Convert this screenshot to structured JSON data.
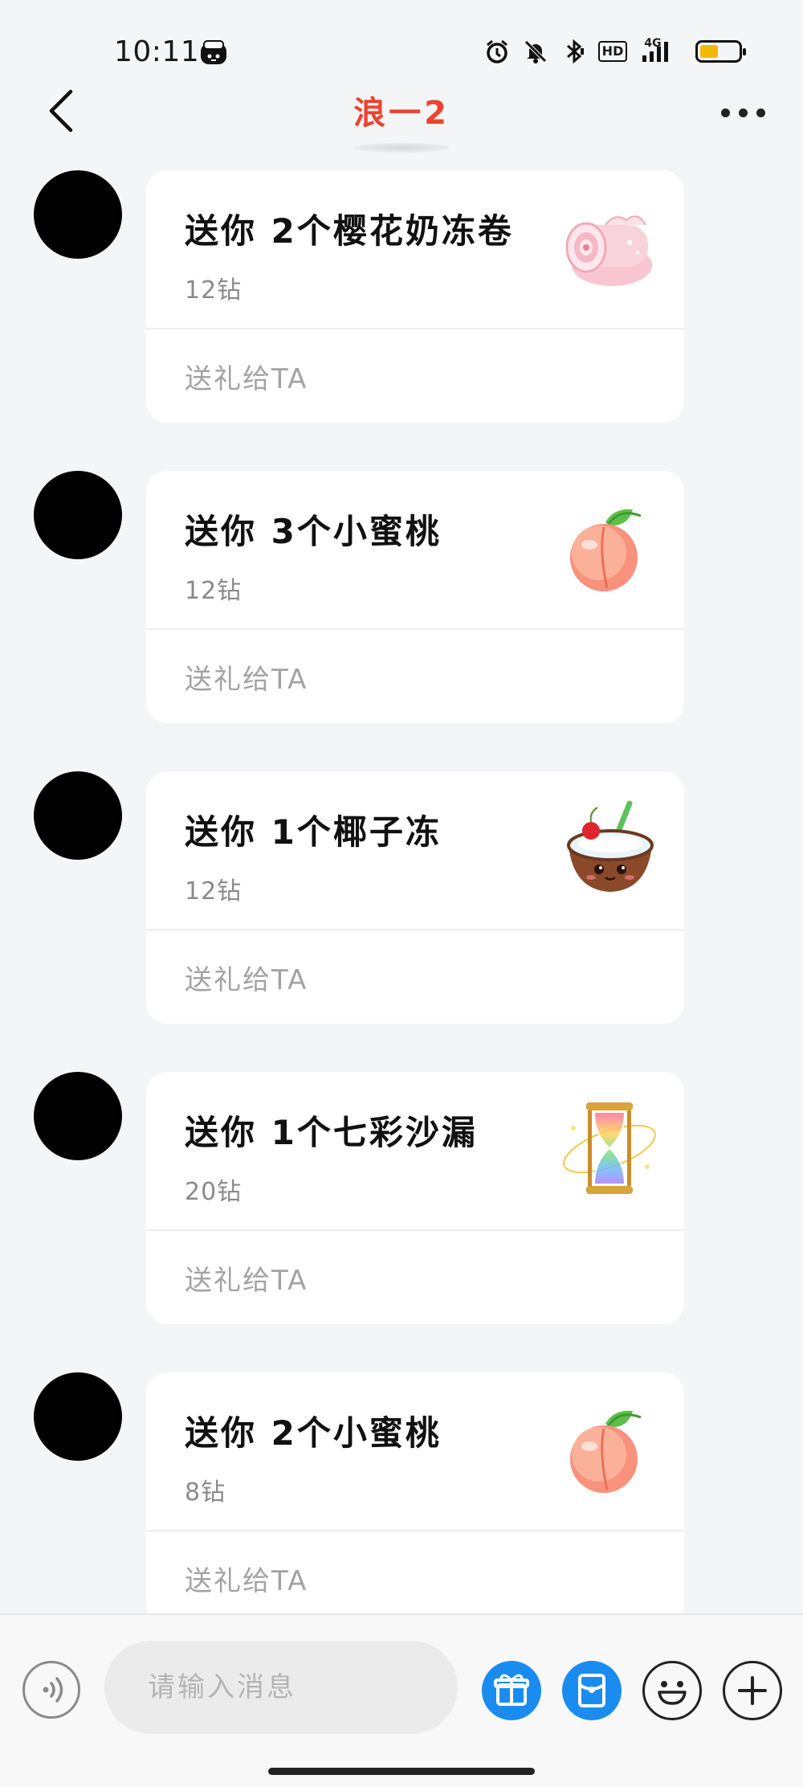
{
  "status_bar": {
    "time": "10:11",
    "hd_label": "HD",
    "network_label": "4G",
    "battery_level": 0.35,
    "icons": [
      "alarm-icon",
      "mute-bell-icon",
      "bluetooth-icon",
      "hd-icon",
      "signal-icon",
      "battery-icon"
    ]
  },
  "nav": {
    "title": "浪一2",
    "title_color": "#f0412f",
    "back_icon": "chevron-left-icon",
    "more_icon": "more-dots-icon"
  },
  "messages": [
    {
      "title": "送你 2个樱花奶冻卷",
      "price": "12钻",
      "action": "送礼给TA",
      "gift_icon": "sakura-roll-cake-icon"
    },
    {
      "title": "送你 3个小蜜桃",
      "price": "12钻",
      "action": "送礼给TA",
      "gift_icon": "peach-icon"
    },
    {
      "title": "送你 1个椰子冻",
      "price": "12钻",
      "action": "送礼给TA",
      "gift_icon": "coconut-jelly-icon"
    },
    {
      "title": "送你 1个七彩沙漏",
      "price": "20钻",
      "action": "送礼给TA",
      "gift_icon": "rainbow-hourglass-icon"
    },
    {
      "title": "送你 2个小蜜桃",
      "price": "8钻",
      "action": "送礼给TA",
      "gift_icon": "peach-icon"
    }
  ],
  "input_bar": {
    "placeholder": "请输入消息",
    "accent_color": "#1a8cf0",
    "buttons": [
      "voice-icon",
      "gift-icon",
      "red-packet-icon",
      "emoji-icon",
      "plus-icon"
    ]
  }
}
